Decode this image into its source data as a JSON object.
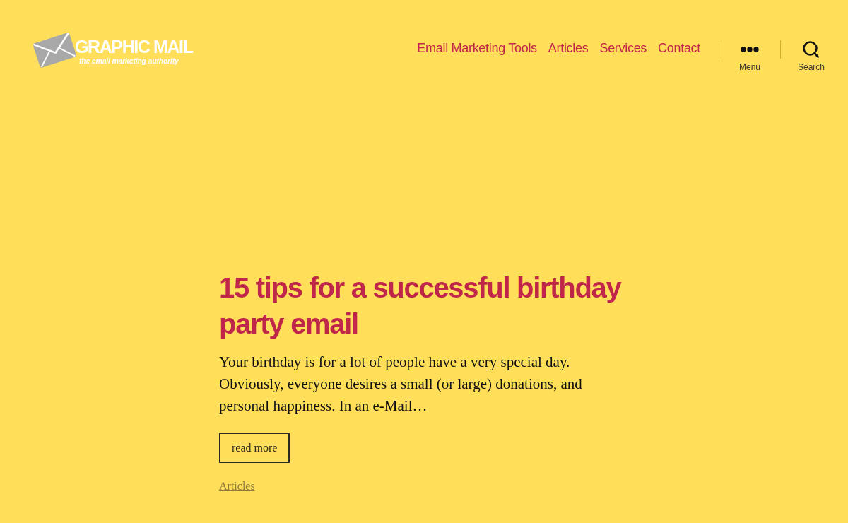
{
  "header": {
    "logo": {
      "name": "GRAPHIC MAIL",
      "tagline": "the email marketing authority"
    },
    "nav": [
      {
        "label": "Email Marketing Tools"
      },
      {
        "label": "Articles"
      },
      {
        "label": "Services"
      },
      {
        "label": "Contact"
      }
    ],
    "toggles": [
      {
        "kind": "menu",
        "label": "Menu"
      },
      {
        "kind": "search",
        "label": "Search"
      }
    ]
  },
  "post": {
    "title": "15 tips for a successful birthday party email",
    "excerpt": "Your birthday is for a lot of people have a very special day. Obviously, everyone desires a small (or large) donations, and personal happiness. In an e-Mail…",
    "button": "read more",
    "category": "Articles"
  }
}
